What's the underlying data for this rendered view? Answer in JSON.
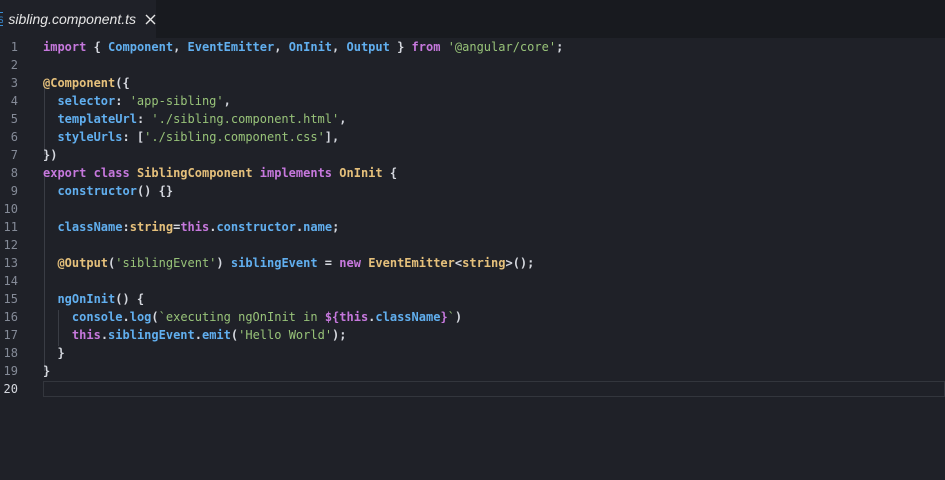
{
  "tab": {
    "title": "sibling.component.ts",
    "close_icon": "close-icon",
    "file_icon": "typescript-file-icon"
  },
  "editor": {
    "active_line": 20,
    "lines": [
      {
        "n": "1",
        "tokens": [
          [
            "k",
            "import"
          ],
          [
            "b",
            " { "
          ],
          [
            "p",
            "Component"
          ],
          [
            "b",
            ", "
          ],
          [
            "p",
            "EventEmitter"
          ],
          [
            "b",
            ", "
          ],
          [
            "p",
            "OnInit"
          ],
          [
            "b",
            ", "
          ],
          [
            "p",
            "Output"
          ],
          [
            "b",
            " } "
          ],
          [
            "k",
            "from"
          ],
          [
            "b",
            " "
          ],
          [
            "s",
            "'@angular/core'"
          ],
          [
            "b",
            ";"
          ]
        ]
      },
      {
        "n": "2",
        "tokens": []
      },
      {
        "n": "3",
        "tokens": [
          [
            "t",
            "@Component"
          ],
          [
            "b",
            "({"
          ]
        ]
      },
      {
        "n": "4",
        "tokens": [
          [
            "b",
            "  "
          ],
          [
            "p",
            "selector"
          ],
          [
            "b",
            ": "
          ],
          [
            "s",
            "'app-sibling'"
          ],
          [
            "b",
            ","
          ]
        ]
      },
      {
        "n": "5",
        "tokens": [
          [
            "b",
            "  "
          ],
          [
            "p",
            "templateUrl"
          ],
          [
            "b",
            ": "
          ],
          [
            "s",
            "'./sibling.component.html'"
          ],
          [
            "b",
            ","
          ]
        ]
      },
      {
        "n": "6",
        "tokens": [
          [
            "b",
            "  "
          ],
          [
            "p",
            "styleUrls"
          ],
          [
            "b",
            ": ["
          ],
          [
            "s",
            "'./sibling.component.css'"
          ],
          [
            "b",
            "],"
          ]
        ]
      },
      {
        "n": "7",
        "tokens": [
          [
            "b",
            "})"
          ]
        ]
      },
      {
        "n": "8",
        "tokens": [
          [
            "k",
            "export"
          ],
          [
            "b",
            " "
          ],
          [
            "k",
            "class"
          ],
          [
            "b",
            " "
          ],
          [
            "t",
            "SiblingComponent"
          ],
          [
            "b",
            " "
          ],
          [
            "k",
            "implements"
          ],
          [
            "b",
            " "
          ],
          [
            "t",
            "OnInit"
          ],
          [
            "b",
            " {"
          ]
        ]
      },
      {
        "n": "9",
        "tokens": [
          [
            "b",
            "  "
          ],
          [
            "p",
            "constructor"
          ],
          [
            "b",
            "() {}"
          ]
        ]
      },
      {
        "n": "10",
        "tokens": []
      },
      {
        "n": "11",
        "tokens": [
          [
            "b",
            "  "
          ],
          [
            "p",
            "className"
          ],
          [
            "b",
            ":"
          ],
          [
            "t",
            "string"
          ],
          [
            "b",
            "="
          ],
          [
            "k",
            "this"
          ],
          [
            "b",
            "."
          ],
          [
            "p",
            "constructor"
          ],
          [
            "b",
            "."
          ],
          [
            "p",
            "name"
          ],
          [
            "b",
            ";"
          ]
        ]
      },
      {
        "n": "12",
        "tokens": []
      },
      {
        "n": "13",
        "tokens": [
          [
            "b",
            "  "
          ],
          [
            "t",
            "@Output"
          ],
          [
            "b",
            "("
          ],
          [
            "s",
            "'siblingEvent'"
          ],
          [
            "b",
            ") "
          ],
          [
            "p",
            "siblingEvent"
          ],
          [
            "b",
            " = "
          ],
          [
            "k",
            "new"
          ],
          [
            "b",
            " "
          ],
          [
            "t",
            "EventEmitter"
          ],
          [
            "b",
            "<"
          ],
          [
            "t",
            "string"
          ],
          [
            "b",
            ">();"
          ]
        ]
      },
      {
        "n": "14",
        "tokens": []
      },
      {
        "n": "15",
        "tokens": [
          [
            "b",
            "  "
          ],
          [
            "p",
            "ngOnInit"
          ],
          [
            "b",
            "() {"
          ]
        ]
      },
      {
        "n": "16",
        "tokens": [
          [
            "b",
            "    "
          ],
          [
            "p",
            "console"
          ],
          [
            "b",
            "."
          ],
          [
            "p",
            "log"
          ],
          [
            "b",
            "("
          ],
          [
            "s",
            "`executing ngOnInit in "
          ],
          [
            "k",
            "${"
          ],
          [
            "k",
            "this"
          ],
          [
            "b",
            "."
          ],
          [
            "p",
            "className"
          ],
          [
            "k",
            "}"
          ],
          [
            "s",
            "`"
          ],
          [
            "b",
            ")"
          ]
        ]
      },
      {
        "n": "17",
        "tokens": [
          [
            "b",
            "    "
          ],
          [
            "k",
            "this"
          ],
          [
            "b",
            "."
          ],
          [
            "p",
            "siblingEvent"
          ],
          [
            "b",
            "."
          ],
          [
            "p",
            "emit"
          ],
          [
            "b",
            "("
          ],
          [
            "s",
            "'Hello World'"
          ],
          [
            "b",
            ");"
          ]
        ]
      },
      {
        "n": "18",
        "tokens": [
          [
            "b",
            "  }"
          ]
        ]
      },
      {
        "n": "19",
        "tokens": [
          [
            "b",
            "}"
          ]
        ]
      },
      {
        "n": "20",
        "tokens": []
      }
    ]
  },
  "colors": {
    "background": "#1f2128",
    "tabbar": "#181a1f",
    "keyword": "#c678dd",
    "string": "#98c379",
    "type": "#e5c07b",
    "identifier": "#61afef"
  }
}
